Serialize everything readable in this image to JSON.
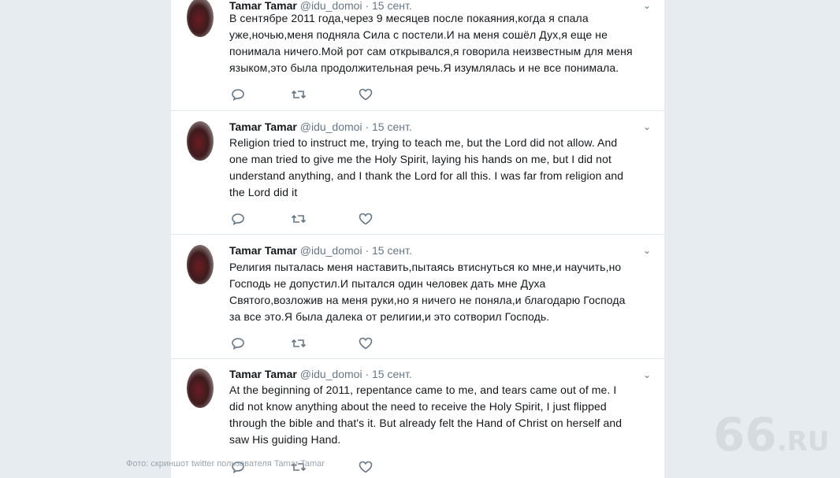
{
  "tweets": [
    {
      "name": "Tamar Tamar",
      "handle": "@idu_domoi",
      "dot": "·",
      "date": "15 сент.",
      "text": "В сентябре 2011 года,через 9 месяцев после покаяния,когда я спала\nуже,ночью,меня подняла Сила с постели.И на меня сошёл Дух,я еще не\nпонимала ничего.Мой рот сам открывался,я говорила неизвестным для меня\nязыком,это была продолжительная речь.Я изумлялась и не все понимала."
    },
    {
      "name": "Tamar Tamar",
      "handle": "@idu_domoi",
      "dot": "·",
      "date": "15 сент.",
      "text": "Religion tried to instruct me, trying to teach me, but the Lord did not allow. And\none man tried to give me the Holy Spirit, laying his hands on me, but I did not\nunderstand anything, and I thank the Lord for all this. I was far from religion and\nthe Lord did it"
    },
    {
      "name": "Tamar Tamar",
      "handle": "@idu_domoi",
      "dot": "·",
      "date": "15 сент.",
      "text": "Религия пыталась меня наставить,пытаясь втиснуться ко мне,и научить,но\nГосподь не допустил.И пытался один человек дать мне Духа\nСвятого,возложив на меня руки,но я ничего не поняла,и благодарю Господа\nза все это.Я была далека от религии,и это сотворил Господь."
    },
    {
      "name": "Tamar Tamar",
      "handle": "@idu_domoi",
      "dot": "·",
      "date": "15 сент.",
      "text": "At the beginning of 2011, repentance came to me, and tears came out of me. I\ndid not know anything about the need to receive the Holy Spirit, I just flipped\nthrough the bible and that's it. But already felt the Hand of Christ on herself and\nsaw His guiding Hand."
    }
  ],
  "credit": "Фото: скриншот twitter пользователя Tamar Tamar",
  "logo": {
    "number": "66",
    "suffix": ".RU"
  },
  "icons": {
    "reply": "reply-icon",
    "retweet": "retweet-icon",
    "like": "like-icon",
    "menu": "chevron-down-icon"
  }
}
